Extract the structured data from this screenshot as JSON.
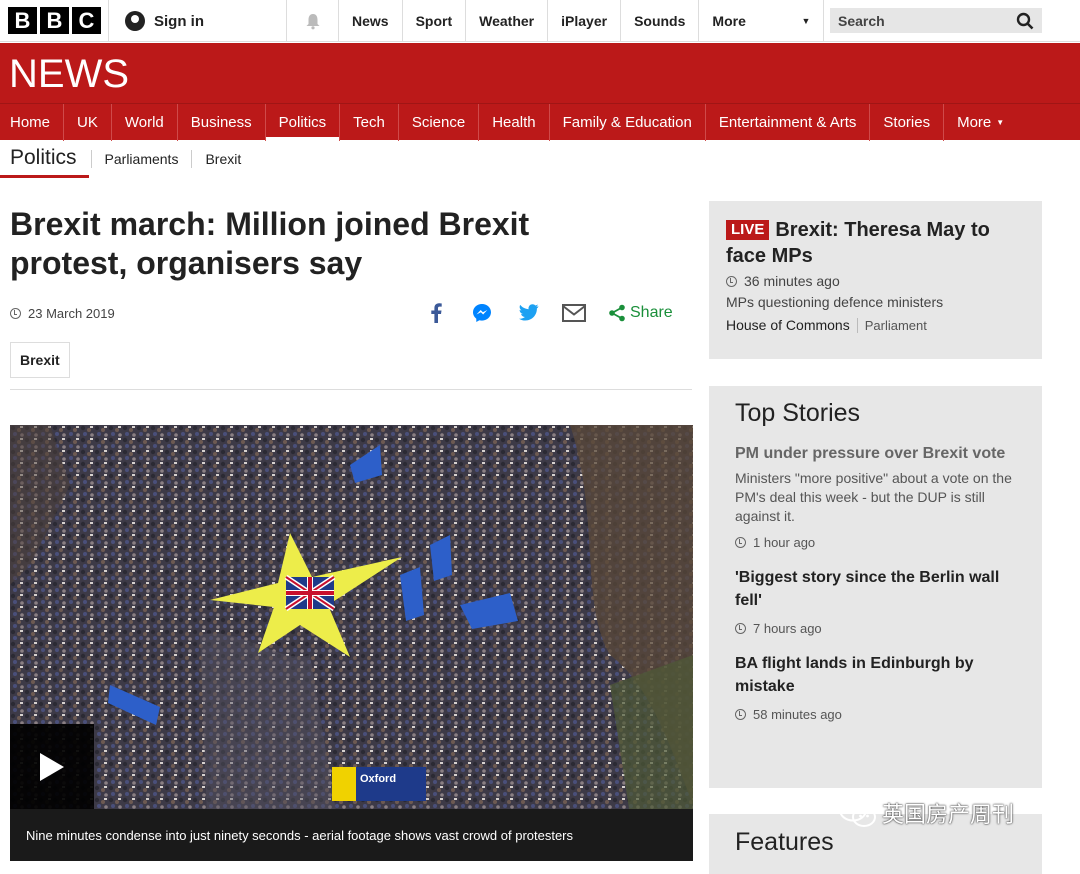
{
  "topbar": {
    "logo_letters": [
      "B",
      "B",
      "C"
    ],
    "signin_label": "Sign in",
    "nav": [
      "News",
      "Sport",
      "Weather",
      "iPlayer",
      "Sounds"
    ],
    "more_label": "More",
    "search_label": "Search"
  },
  "banner": {
    "title": "NEWS"
  },
  "section_nav": {
    "items": [
      "Home",
      "UK",
      "World",
      "Business",
      "Politics",
      "Tech",
      "Science",
      "Health",
      "Family & Education",
      "Entertainment & Arts",
      "Stories"
    ],
    "active": "Politics",
    "more_label": "More"
  },
  "sub_nav": {
    "title": "Politics",
    "links": [
      "Parliaments",
      "Brexit"
    ]
  },
  "article": {
    "headline": "Brexit march: Million joined Brexit protest, organisers say",
    "date": "23 March 2019",
    "share_label": "Share",
    "tag": "Brexit",
    "media_caption": "Nine minutes condense into just ninety seconds - aerial footage shows vast crowd of protesters"
  },
  "live": {
    "badge": "LIVE",
    "title": "Brexit: Theresa May to face MPs",
    "time": "36 minutes ago",
    "summary": "MPs questioning defence ministers",
    "source": "House of Commons",
    "source_section": "Parliament"
  },
  "top_stories": {
    "title": "Top Stories",
    "stories": [
      {
        "title": "PM under pressure over Brexit vote",
        "summary": "Ministers \"more positive\" about a vote on the PM's deal this week - but the DUP is still against it.",
        "time": "1 hour ago"
      },
      {
        "title": "'Biggest story since the Berlin wall fell'",
        "time": "7 hours ago"
      },
      {
        "title": "BA flight lands in Edinburgh by mistake",
        "time": "58 minutes ago"
      }
    ]
  },
  "features": {
    "title": "Features"
  },
  "watermark": {
    "text": "英国房产周刊"
  },
  "colors": {
    "brand_red": "#bb1919",
    "share_green": "#1a8f3a",
    "panel_grey": "#e7e7e7"
  }
}
